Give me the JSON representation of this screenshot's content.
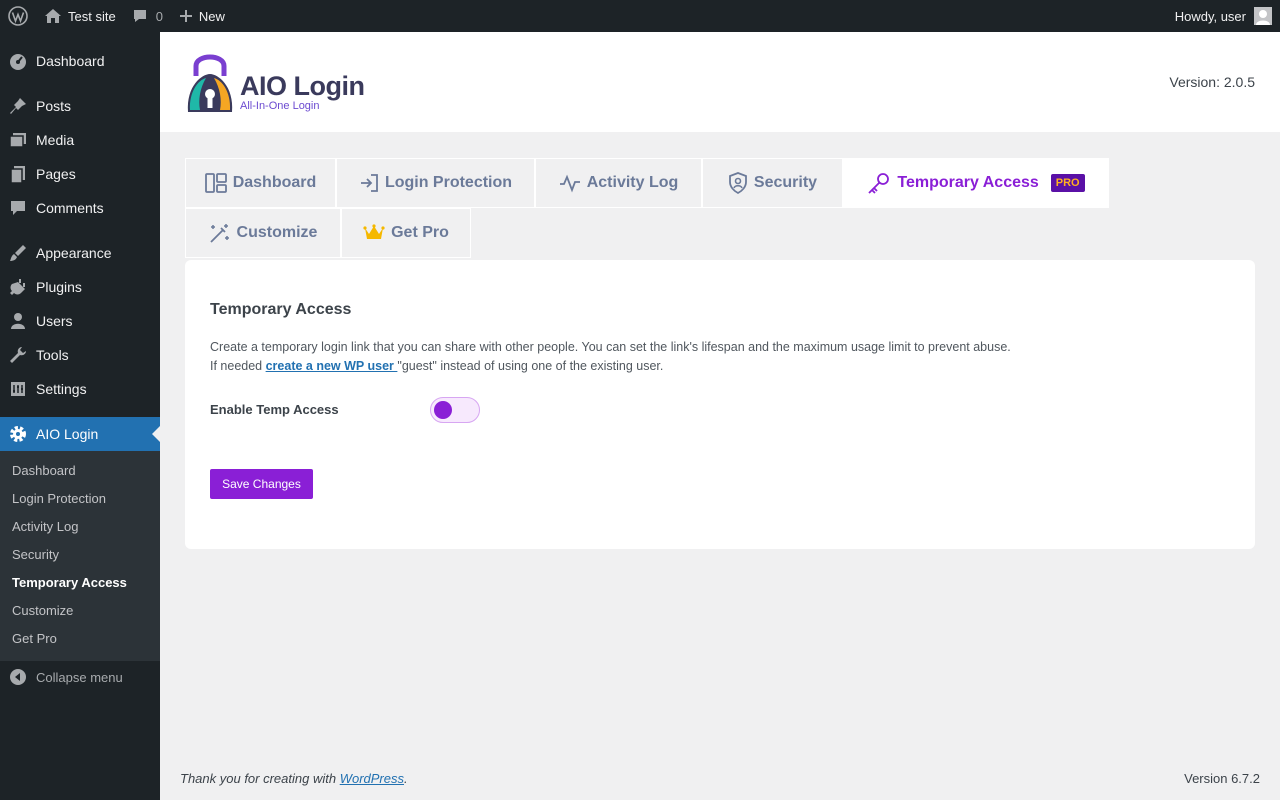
{
  "adminbar": {
    "site_name": "Test site",
    "comments_count": "0",
    "new_label": "New",
    "howdy": "Howdy, user"
  },
  "sidebar": {
    "items": [
      {
        "label": "Dashboard",
        "icon": "dashboard-icon"
      },
      {
        "label": "Posts",
        "icon": "pin-icon"
      },
      {
        "label": "Media",
        "icon": "media-icon"
      },
      {
        "label": "Pages",
        "icon": "pages-icon"
      },
      {
        "label": "Comments",
        "icon": "comment-icon"
      },
      {
        "label": "Appearance",
        "icon": "brush-icon"
      },
      {
        "label": "Plugins",
        "icon": "plugin-icon"
      },
      {
        "label": "Users",
        "icon": "user-icon"
      },
      {
        "label": "Tools",
        "icon": "wrench-icon"
      },
      {
        "label": "Settings",
        "icon": "settings-icon"
      },
      {
        "label": "AIO Login",
        "icon": "gear-icon"
      }
    ],
    "submenu": [
      "Dashboard",
      "Login Protection",
      "Activity Log",
      "Security",
      "Temporary Access",
      "Customize",
      "Get Pro"
    ],
    "collapse_label": "Collapse menu"
  },
  "header": {
    "logo_title": "AIO Login",
    "logo_subtitle": "All-In-One Login",
    "version": "Version: 2.0.5"
  },
  "tabs": {
    "dashboard": "Dashboard",
    "login_protection": "Login Protection",
    "activity_log": "Activity Log",
    "security": "Security",
    "temporary_access": "Temporary Access",
    "pro_badge": "PRO",
    "customize": "Customize",
    "get_pro": "Get Pro"
  },
  "panel": {
    "title": "Temporary Access",
    "desc_line1": "Create a temporary login link that you can share with other people. You can set the link's lifespan and the maximum usage limit to prevent abuse.",
    "desc_line2_prefix": "If needed ",
    "desc_link": "create a new WP user ",
    "desc_line2_suffix": "\"guest\" instead of using one of the existing user.",
    "toggle_label": "Enable Temp Access",
    "save_label": "Save Changes"
  },
  "footer": {
    "thanks_prefix": "Thank you for creating with ",
    "wordpress_link": "WordPress",
    "thanks_suffix": ".",
    "version": "Version 6.7.2"
  },
  "colors": {
    "accent": "#8a1fd6",
    "admin_dark": "#1d2327",
    "admin_blue": "#2271b1"
  }
}
